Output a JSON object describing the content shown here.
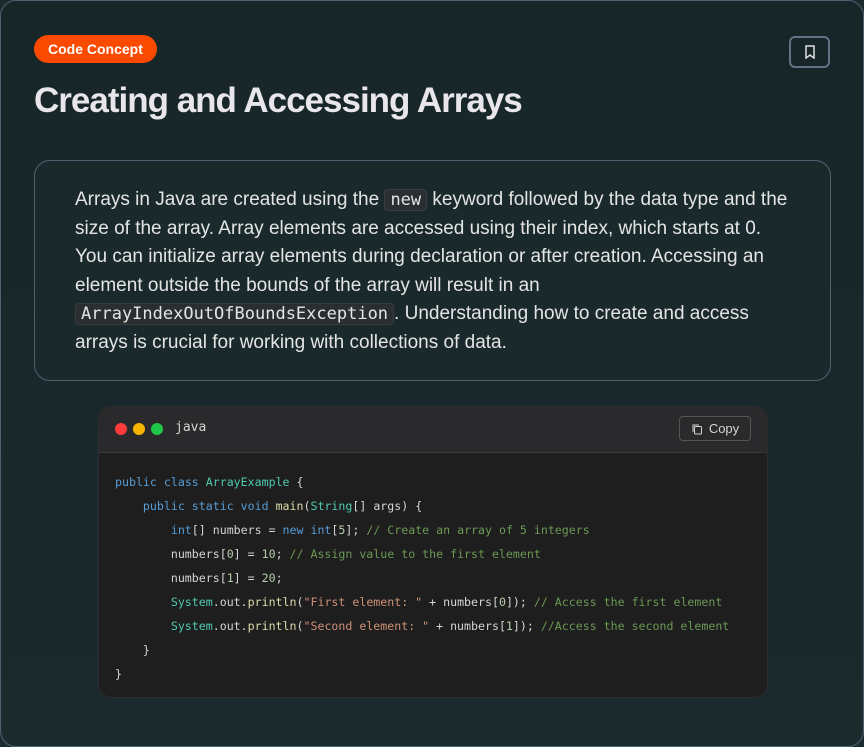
{
  "badge": {
    "label": "Code Concept",
    "color": "#fa4a00"
  },
  "bookmark": {
    "icon": "bookmark-icon"
  },
  "title": "Creating and Accessing Arrays",
  "description": {
    "part1": "Arrays in Java are created using the ",
    "code1": "new",
    "part2": " keyword followed by the data type and the size of the array. Array elements are accessed using their index, which starts at 0. You can initialize array elements during declaration or after creation. Accessing an element outside the bounds of the array will result in an ",
    "code2": "ArrayIndexOutOfBoundsException",
    "part3": ". Understanding how to create and access arrays is crucial for working with collections of data."
  },
  "code_block": {
    "language": "java",
    "copy_label": "Copy",
    "copy_icon": "copy-icon",
    "window_dots": [
      "#ff3b3b",
      "#f5b400",
      "#1fc64a"
    ],
    "lines": [
      [
        [
          "kw",
          "public "
        ],
        [
          "kw",
          "class "
        ],
        [
          "cls",
          "ArrayExample"
        ],
        [
          "tx",
          " {"
        ]
      ],
      [
        [
          "tx",
          "    "
        ],
        [
          "kw",
          "public "
        ],
        [
          "kw",
          "static "
        ],
        [
          "kw",
          "void "
        ],
        [
          "fn",
          "main"
        ],
        [
          "tx",
          "("
        ],
        [
          "cls",
          "String"
        ],
        [
          "tx",
          "[] args) {"
        ]
      ],
      [
        [
          "tx",
          "        "
        ],
        [
          "kw",
          "int"
        ],
        [
          "tx",
          "[] numbers = "
        ],
        [
          "kw",
          "new "
        ],
        [
          "kw",
          "int"
        ],
        [
          "tx",
          "["
        ],
        [
          "num",
          "5"
        ],
        [
          "tx",
          "]; "
        ],
        [
          "cm",
          "// Create an array of 5 integers"
        ]
      ],
      [
        [
          "tx",
          "        numbers["
        ],
        [
          "num",
          "0"
        ],
        [
          "tx",
          "] = "
        ],
        [
          "num",
          "10"
        ],
        [
          "tx",
          "; "
        ],
        [
          "cm",
          "// Assign value to the first element"
        ]
      ],
      [
        [
          "tx",
          "        numbers["
        ],
        [
          "num",
          "1"
        ],
        [
          "tx",
          "] = "
        ],
        [
          "num",
          "20"
        ],
        [
          "tx",
          ";"
        ]
      ],
      [
        [
          "tx",
          "        "
        ],
        [
          "cls",
          "System"
        ],
        [
          "tx",
          ".out."
        ],
        [
          "fn",
          "println"
        ],
        [
          "tx",
          "("
        ],
        [
          "str",
          "\"First element: \""
        ],
        [
          "tx",
          " + numbers["
        ],
        [
          "num",
          "0"
        ],
        [
          "tx",
          "]); "
        ],
        [
          "cm",
          "// Access the first element"
        ]
      ],
      [
        [
          "tx",
          "        "
        ],
        [
          "cls",
          "System"
        ],
        [
          "tx",
          ".out."
        ],
        [
          "fn",
          "println"
        ],
        [
          "tx",
          "("
        ],
        [
          "str",
          "\"Second element: \""
        ],
        [
          "tx",
          " + numbers["
        ],
        [
          "num",
          "1"
        ],
        [
          "tx",
          "]); "
        ],
        [
          "cm",
          "//Access the second element"
        ]
      ],
      [
        [
          "tx",
          "    }"
        ]
      ],
      [
        [
          "tx",
          "}"
        ]
      ]
    ]
  }
}
